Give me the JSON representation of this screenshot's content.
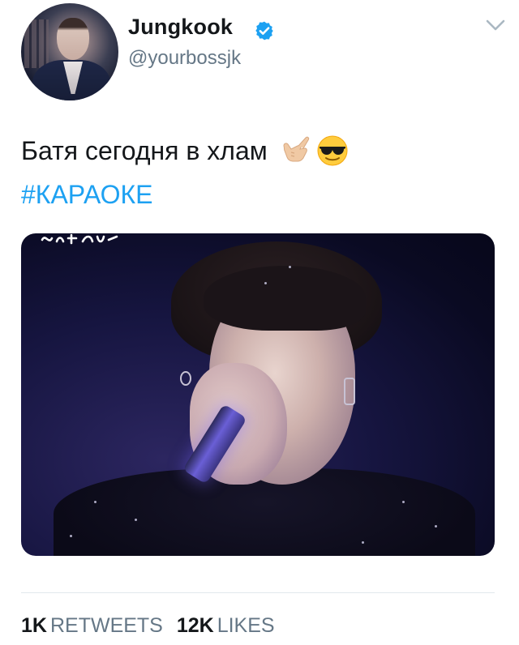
{
  "user": {
    "display_name": "Jungkook",
    "handle": "@yourbossjk",
    "verified": true,
    "avatar": "profile-photo"
  },
  "tweet": {
    "text": "Батя сегодня в хлам",
    "emojis": [
      "call-me-hand-emoji",
      "sunglasses-face-emoji"
    ],
    "hashtag": "#КАРАОКЕ",
    "media": "photo-singer-with-microphone"
  },
  "stats": {
    "retweets_count": "1K",
    "retweets_label": "RETWEETS",
    "likes_count": "12K",
    "likes_label": "LIKES"
  },
  "icons": {
    "verified": "verified-badge-icon",
    "menu": "chevron-down-icon"
  },
  "colors": {
    "link": "#1da1f2",
    "secondary_text": "#657786",
    "primary_text": "#14171a",
    "verified": "#1da1f2"
  }
}
